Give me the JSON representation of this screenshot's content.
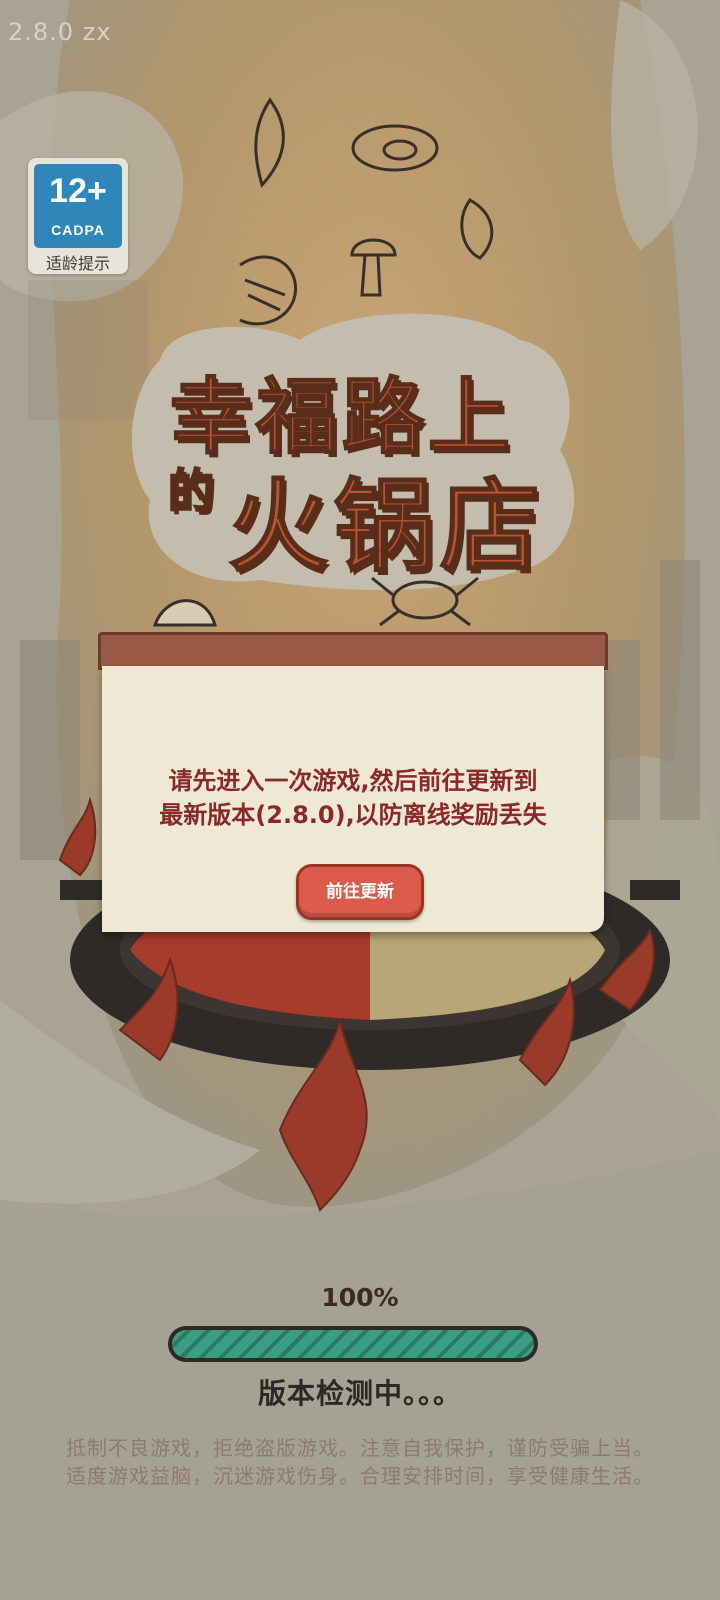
{
  "version_text": "2.8.0  zx",
  "age_rating": {
    "number": "12+",
    "org": "CADPA",
    "tip": "适龄提示"
  },
  "title": {
    "line1": "幸福路上",
    "line2_small": "的",
    "line2_large": "火锅店"
  },
  "dialog": {
    "message_line1": "请先进入一次游戏,然后前往更新到",
    "message_line2": "最新版本(2.8.0),以防离线奖励丢失",
    "button_label": "前往更新"
  },
  "loading": {
    "percent_text": "100%",
    "progress": 1.0,
    "status": "版本检测中。。。"
  },
  "health_notice": {
    "line1": "抵制不良游戏，拒绝盗版游戏。注意自我保护，谨防受骗上当。",
    "line2": "适度游戏益脑，沉迷游戏伤身。合理安排时间，享受健康生活。"
  },
  "icons": [
    "shrimp-icon",
    "mushroom-icon",
    "herb-icon",
    "oyster-icon",
    "crab-icon",
    "scallop-icon",
    "hotpot-icon",
    "flame-icon"
  ],
  "colors": {
    "accent": "#dc5b4b",
    "title": "#b8542f",
    "dialog_header": "#9b5a48",
    "progress": "#3a9f80",
    "message": "#8a2a28"
  }
}
